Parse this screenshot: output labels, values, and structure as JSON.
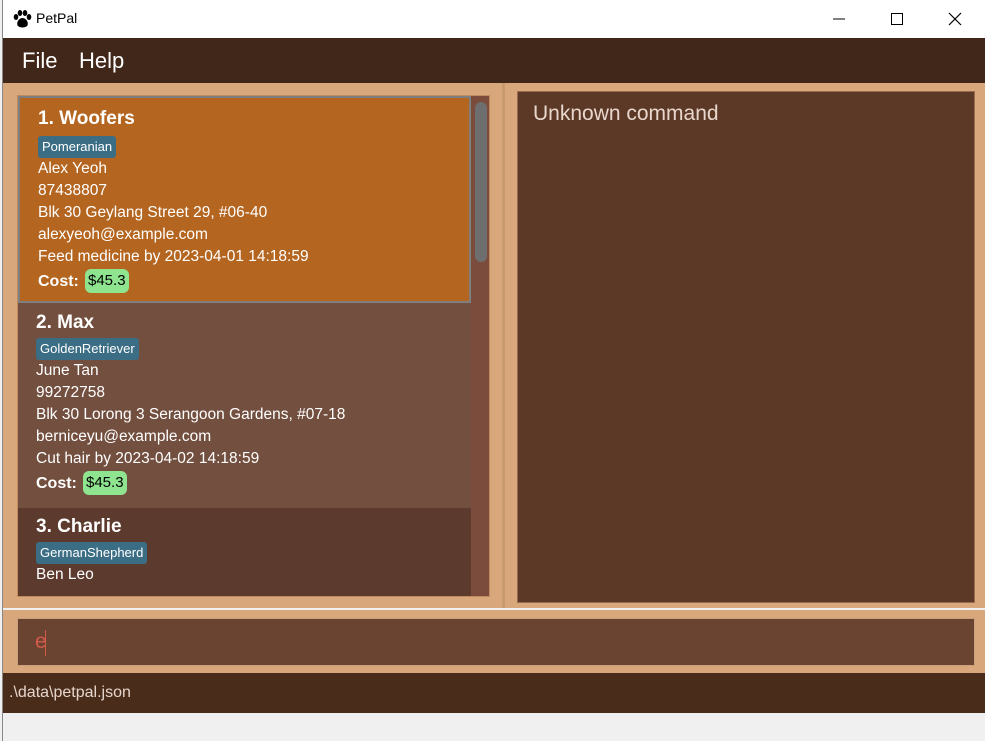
{
  "window": {
    "title": "PetPal"
  },
  "menu": {
    "file": "File",
    "help": "Help"
  },
  "pets": [
    {
      "index_name": "1.  Woofers",
      "tag": "Pomeranian",
      "owner": "Alex Yeoh",
      "phone": "87438807",
      "address": "Blk 30 Geylang Street 29, #06-40",
      "email": "alexyeoh@example.com",
      "todo": "Feed medicine by 2023-04-01 14:18:59",
      "cost_label": "Cost:",
      "cost": "$45.3"
    },
    {
      "index_name": "2.  Max",
      "tag": "GoldenRetriever",
      "owner": "June Tan",
      "phone": "99272758",
      "address": "Blk 30 Lorong 3 Serangoon Gardens, #07-18",
      "email": "berniceyu@example.com",
      "todo": "Cut hair by 2023-04-02 14:18:59",
      "cost_label": "Cost:",
      "cost": "$45.3"
    },
    {
      "index_name": "3.  Charlie",
      "tag": "GermanShepherd",
      "owner": "Ben Leo"
    }
  ],
  "result": {
    "message": "Unknown command"
  },
  "command": {
    "value": "e"
  },
  "status": {
    "file_path": ".\\data\\petpal.json"
  },
  "colors": {
    "menubar": "#41271a",
    "selected_card": "#b4651f",
    "tag": "#3b6e85",
    "cost_badge": "#8fe58f",
    "result_panel": "#5c3827"
  }
}
